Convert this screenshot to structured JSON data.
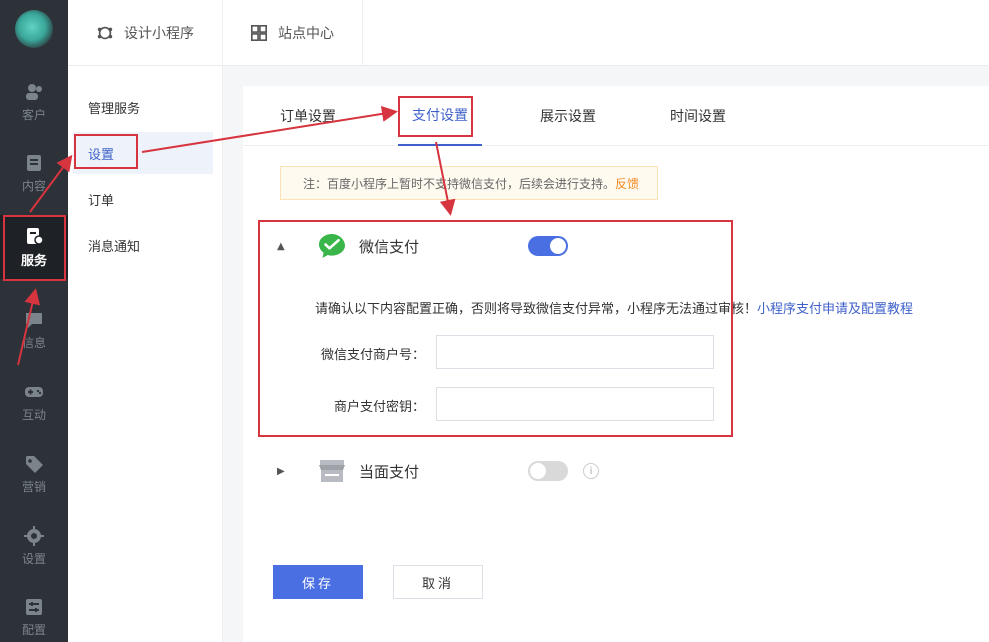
{
  "sidebar": {
    "items": [
      {
        "label": "客户",
        "icon": "users-icon"
      },
      {
        "label": "内容",
        "icon": "document-icon"
      },
      {
        "label": "服务",
        "icon": "service-icon"
      },
      {
        "label": "信息",
        "icon": "message-icon"
      },
      {
        "label": "互动",
        "icon": "gamepad-icon"
      },
      {
        "label": "营销",
        "icon": "tag-icon"
      },
      {
        "label": "设置",
        "icon": "gear-icon"
      },
      {
        "label": "配置",
        "icon": "config-icon"
      }
    ],
    "active": "服务"
  },
  "header": {
    "tabs": [
      {
        "label": "设计小程序",
        "icon": "design-icon"
      },
      {
        "label": "站点中心",
        "icon": "grid-icon"
      }
    ]
  },
  "submenu": {
    "items": [
      "管理服务",
      "设置",
      "订单",
      "消息通知"
    ],
    "active": "设置"
  },
  "main": {
    "tabs": [
      "订单设置",
      "支付设置",
      "展示设置",
      "时间设置"
    ],
    "active_tab": "支付设置",
    "notice": {
      "text": "注：百度小程序上暂时不支持微信支付，后续会进行支持。",
      "link": "反馈"
    },
    "wechat_pay": {
      "title": "微信支付",
      "enabled": true,
      "confirm_text": "请确认以下内容配置正确，否则将导致微信支付异常，小程序无法通过审核！",
      "confirm_link": "小程序支付申请及配置教程",
      "merchant_id_label": "微信支付商户号：",
      "merchant_key_label": "商户支付密钥：",
      "merchant_id_value": "",
      "merchant_key_value": ""
    },
    "face_pay": {
      "title": "当面支付",
      "enabled": false,
      "info": "i"
    },
    "buttons": {
      "save": "保存",
      "cancel": "取消"
    }
  },
  "colors": {
    "accent": "#4a6fe3",
    "link": "#3f61c9",
    "annotation": "#d6343f",
    "wechat_green": "#39b54a",
    "sidebar_bg": "#2c3238"
  }
}
